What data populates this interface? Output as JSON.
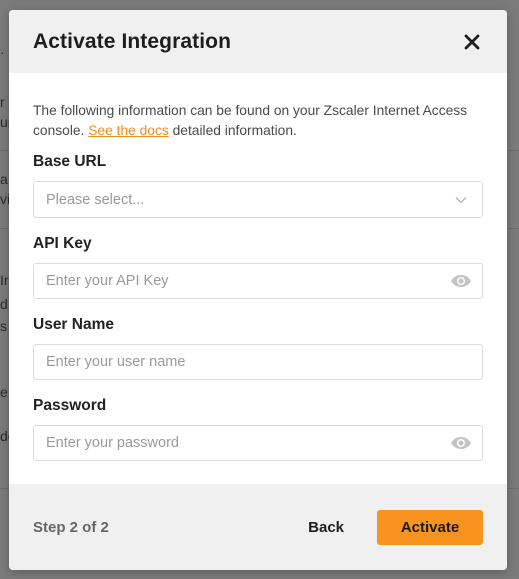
{
  "background": {
    "fragments": [
      "·",
      "r",
      "ur",
      "a",
      "vi",
      "Ir",
      "d",
      "s",
      "e",
      "de"
    ]
  },
  "modal": {
    "title": "Activate Integration",
    "close_icon": "close-icon",
    "intro_before": "The following information can be found on your Zscaler Internet Access console. ",
    "intro_link": "See the docs",
    "intro_after": " detailed information.",
    "fields": {
      "base_url": {
        "label": "Base URL",
        "placeholder": "Please select...",
        "icon": "chevron-down-icon"
      },
      "api_key": {
        "label": "API Key",
        "placeholder": "Enter your API Key",
        "value": "",
        "icon": "eye-icon"
      },
      "user_name": {
        "label": "User Name",
        "placeholder": "Enter your user name",
        "value": ""
      },
      "password": {
        "label": "Password",
        "placeholder": "Enter your password",
        "value": "",
        "icon": "eye-icon"
      }
    },
    "footer": {
      "step": "Step 2 of 2",
      "back_label": "Back",
      "activate_label": "Activate"
    }
  },
  "colors": {
    "accent": "#f7931e",
    "link": "#f28c1e",
    "header_bg": "#f0f0f0",
    "overlay": "#7b7b7b"
  }
}
